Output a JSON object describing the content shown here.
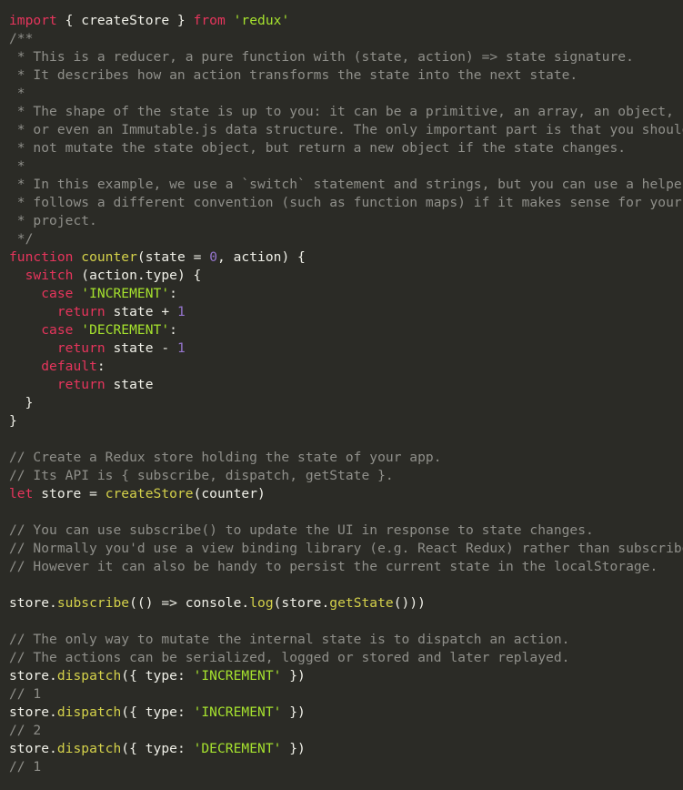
{
  "editor": {
    "language": "javascript",
    "background_color": "#2b2b26",
    "theme_name": "dark",
    "colors": {
      "background": "#2b2b26",
      "keyword": "#e6355c",
      "string": "#a6e22e",
      "function": "#d4d14a",
      "number": "#9575cd",
      "plain": "#f0f0e8",
      "comment": "#8f8f8a"
    }
  },
  "code": {
    "lines": [
      {
        "tokens": [
          {
            "t": "import",
            "c": "kw"
          },
          {
            "t": " { createStore } ",
            "c": "plain"
          },
          {
            "t": "from",
            "c": "kw"
          },
          {
            "t": " ",
            "c": "plain"
          },
          {
            "t": "'redux'",
            "c": "str"
          }
        ]
      },
      {
        "tokens": [
          {
            "t": "/**",
            "c": "comment"
          }
        ]
      },
      {
        "tokens": [
          {
            "t": " * This is a reducer, a pure function with (state, action) => state signature.",
            "c": "comment"
          }
        ]
      },
      {
        "tokens": [
          {
            "t": " * It describes how an action transforms the state into the next state.",
            "c": "comment"
          }
        ]
      },
      {
        "tokens": [
          {
            "t": " *",
            "c": "comment"
          }
        ]
      },
      {
        "tokens": [
          {
            "t": " * The shape of the state is up to you: it can be a primitive, an array, an object,",
            "c": "comment"
          }
        ]
      },
      {
        "tokens": [
          {
            "t": " * or even an Immutable.js data structure. The only important part is that you should",
            "c": "comment"
          }
        ]
      },
      {
        "tokens": [
          {
            "t": " * not mutate the state object, but return a new object if the state changes.",
            "c": "comment"
          }
        ]
      },
      {
        "tokens": [
          {
            "t": " *",
            "c": "comment"
          }
        ]
      },
      {
        "tokens": [
          {
            "t": " * In this example, we use a `switch` statement and strings, but you can use a helper that",
            "c": "comment"
          }
        ]
      },
      {
        "tokens": [
          {
            "t": " * follows a different convention (such as function maps) if it makes sense for your",
            "c": "comment"
          }
        ]
      },
      {
        "tokens": [
          {
            "t": " * project.",
            "c": "comment"
          }
        ]
      },
      {
        "tokens": [
          {
            "t": " */",
            "c": "comment"
          }
        ]
      },
      {
        "tokens": [
          {
            "t": "function",
            "c": "kw"
          },
          {
            "t": " ",
            "c": "plain"
          },
          {
            "t": "counter",
            "c": "fn"
          },
          {
            "t": "(state = ",
            "c": "plain"
          },
          {
            "t": "0",
            "c": "num"
          },
          {
            "t": ", action) {",
            "c": "plain"
          }
        ]
      },
      {
        "tokens": [
          {
            "t": "  ",
            "c": "plain"
          },
          {
            "t": "switch",
            "c": "kw"
          },
          {
            "t": " (action.type) {",
            "c": "plain"
          }
        ]
      },
      {
        "tokens": [
          {
            "t": "    ",
            "c": "plain"
          },
          {
            "t": "case",
            "c": "kw"
          },
          {
            "t": " ",
            "c": "plain"
          },
          {
            "t": "'INCREMENT'",
            "c": "str"
          },
          {
            "t": ":",
            "c": "plain"
          }
        ]
      },
      {
        "tokens": [
          {
            "t": "      ",
            "c": "plain"
          },
          {
            "t": "return",
            "c": "kw"
          },
          {
            "t": " state + ",
            "c": "plain"
          },
          {
            "t": "1",
            "c": "num"
          }
        ]
      },
      {
        "tokens": [
          {
            "t": "    ",
            "c": "plain"
          },
          {
            "t": "case",
            "c": "kw"
          },
          {
            "t": " ",
            "c": "plain"
          },
          {
            "t": "'DECREMENT'",
            "c": "str"
          },
          {
            "t": ":",
            "c": "plain"
          }
        ]
      },
      {
        "tokens": [
          {
            "t": "      ",
            "c": "plain"
          },
          {
            "t": "return",
            "c": "kw"
          },
          {
            "t": " state - ",
            "c": "plain"
          },
          {
            "t": "1",
            "c": "num"
          }
        ]
      },
      {
        "tokens": [
          {
            "t": "    ",
            "c": "plain"
          },
          {
            "t": "default",
            "c": "kw"
          },
          {
            "t": ":",
            "c": "plain"
          }
        ]
      },
      {
        "tokens": [
          {
            "t": "      ",
            "c": "plain"
          },
          {
            "t": "return",
            "c": "kw"
          },
          {
            "t": " state",
            "c": "plain"
          }
        ]
      },
      {
        "tokens": [
          {
            "t": "  }",
            "c": "plain"
          }
        ]
      },
      {
        "tokens": [
          {
            "t": "}",
            "c": "plain"
          }
        ]
      },
      {
        "tokens": [
          {
            "t": "",
            "c": "plain"
          }
        ]
      },
      {
        "tokens": [
          {
            "t": "// Create a Redux store holding the state of your app.",
            "c": "comment"
          }
        ]
      },
      {
        "tokens": [
          {
            "t": "// Its API is { subscribe, dispatch, getState }.",
            "c": "comment"
          }
        ]
      },
      {
        "tokens": [
          {
            "t": "let",
            "c": "kw"
          },
          {
            "t": " store = ",
            "c": "plain"
          },
          {
            "t": "createStore",
            "c": "fn"
          },
          {
            "t": "(counter)",
            "c": "plain"
          }
        ]
      },
      {
        "tokens": [
          {
            "t": "",
            "c": "plain"
          }
        ]
      },
      {
        "tokens": [
          {
            "t": "// You can use subscribe() to update the UI in response to state changes.",
            "c": "comment"
          }
        ]
      },
      {
        "tokens": [
          {
            "t": "// Normally you'd use a view binding library (e.g. React Redux) rather than subscribe() directly.",
            "c": "comment"
          }
        ]
      },
      {
        "tokens": [
          {
            "t": "// However it can also be handy to persist the current state in the localStorage.",
            "c": "comment"
          }
        ]
      },
      {
        "tokens": [
          {
            "t": "",
            "c": "plain"
          }
        ]
      },
      {
        "tokens": [
          {
            "t": "store.",
            "c": "plain"
          },
          {
            "t": "subscribe",
            "c": "fn"
          },
          {
            "t": "(() => console.",
            "c": "plain"
          },
          {
            "t": "log",
            "c": "fn"
          },
          {
            "t": "(store.",
            "c": "plain"
          },
          {
            "t": "getState",
            "c": "fn"
          },
          {
            "t": "()))",
            "c": "plain"
          }
        ]
      },
      {
        "tokens": [
          {
            "t": "",
            "c": "plain"
          }
        ]
      },
      {
        "tokens": [
          {
            "t": "// The only way to mutate the internal state is to dispatch an action.",
            "c": "comment"
          }
        ]
      },
      {
        "tokens": [
          {
            "t": "// The actions can be serialized, logged or stored and later replayed.",
            "c": "comment"
          }
        ]
      },
      {
        "tokens": [
          {
            "t": "store.",
            "c": "plain"
          },
          {
            "t": "dispatch",
            "c": "fn"
          },
          {
            "t": "({ type: ",
            "c": "plain"
          },
          {
            "t": "'INCREMENT'",
            "c": "str"
          },
          {
            "t": " })",
            "c": "plain"
          }
        ]
      },
      {
        "tokens": [
          {
            "t": "// 1",
            "c": "comment"
          }
        ]
      },
      {
        "tokens": [
          {
            "t": "store.",
            "c": "plain"
          },
          {
            "t": "dispatch",
            "c": "fn"
          },
          {
            "t": "({ type: ",
            "c": "plain"
          },
          {
            "t": "'INCREMENT'",
            "c": "str"
          },
          {
            "t": " })",
            "c": "plain"
          }
        ]
      },
      {
        "tokens": [
          {
            "t": "// 2",
            "c": "comment"
          }
        ]
      },
      {
        "tokens": [
          {
            "t": "store.",
            "c": "plain"
          },
          {
            "t": "dispatch",
            "c": "fn"
          },
          {
            "t": "({ type: ",
            "c": "plain"
          },
          {
            "t": "'DECREMENT'",
            "c": "str"
          },
          {
            "t": " })",
            "c": "plain"
          }
        ]
      },
      {
        "tokens": [
          {
            "t": "// 1",
            "c": "comment"
          }
        ]
      }
    ]
  }
}
